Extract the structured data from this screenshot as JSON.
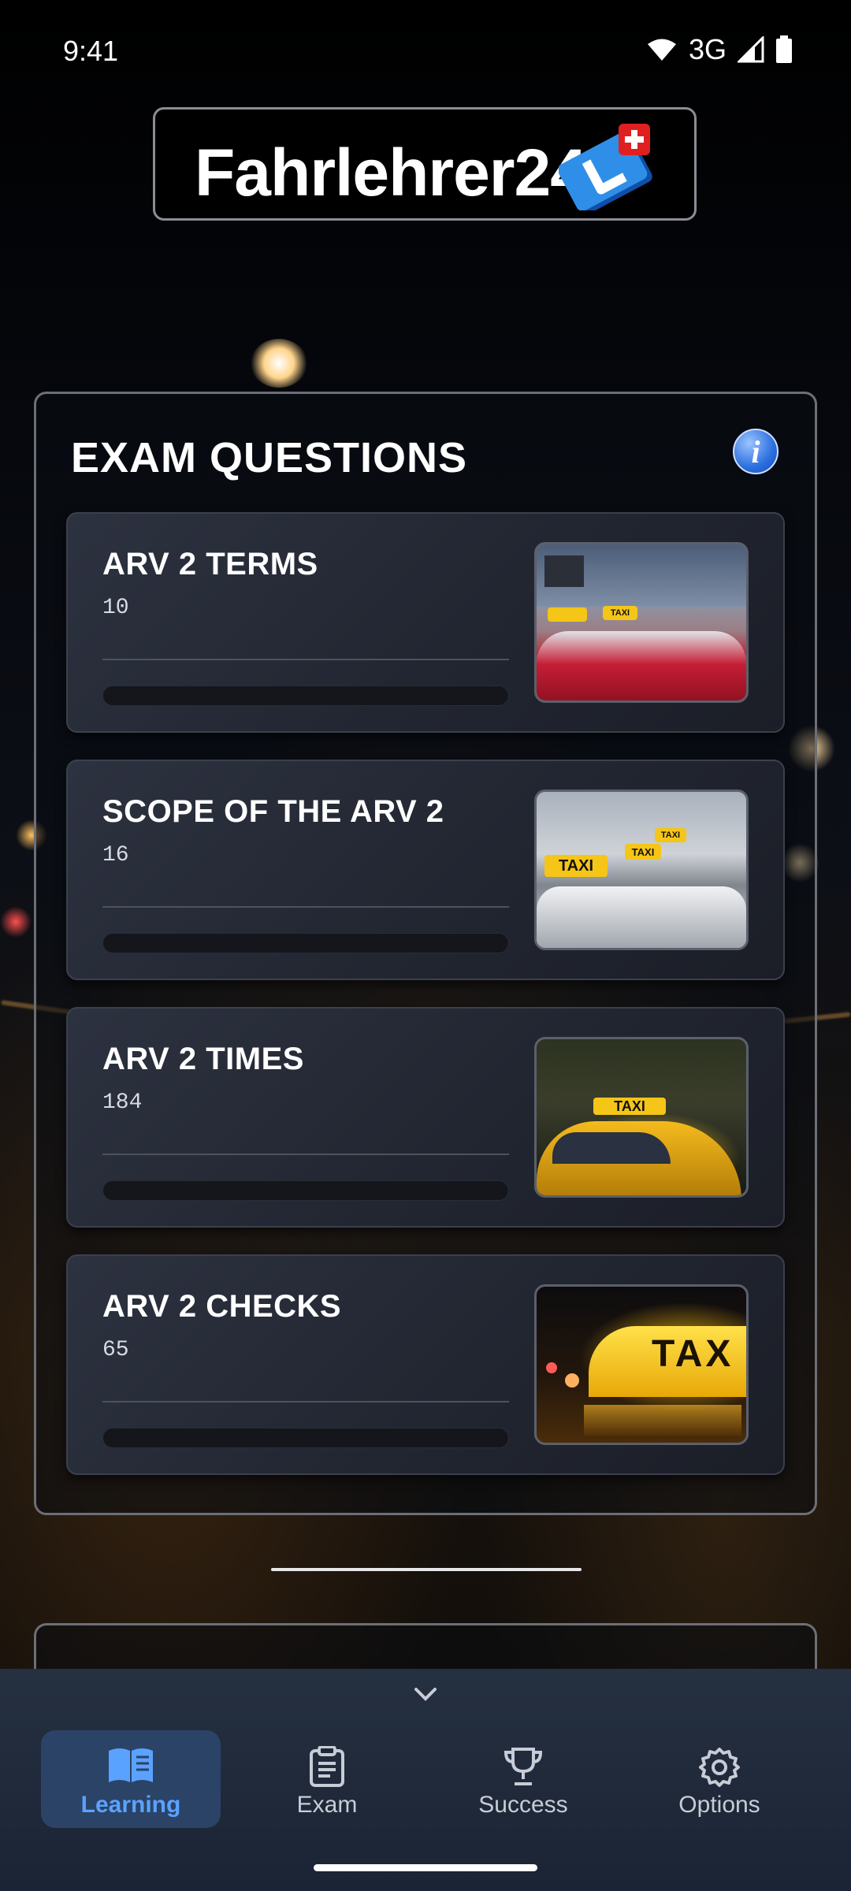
{
  "status_bar": {
    "time": "9:41",
    "network": "3G"
  },
  "logo": {
    "text": "Fahrlehrer24"
  },
  "exam_panel": {
    "title": "EXAM QUESTIONS",
    "cards": [
      {
        "title": "ARV 2 TERMS",
        "count": "10",
        "progress": 0
      },
      {
        "title": "SCOPE OF THE ARV 2",
        "count": "16",
        "progress": 0
      },
      {
        "title": "ARV 2 TIMES",
        "count": "184",
        "progress": 0
      },
      {
        "title": "ARV 2 CHECKS",
        "count": "65",
        "progress": 0
      }
    ]
  },
  "thumb_signs": {
    "taxi": "TAXI",
    "taxi_partial": "TAX"
  },
  "bottom_nav": {
    "items": [
      {
        "label": "Learning",
        "icon": "book-icon",
        "active": true
      },
      {
        "label": "Exam",
        "icon": "clipboard-icon",
        "active": false
      },
      {
        "label": "Success",
        "icon": "trophy-icon",
        "active": false
      },
      {
        "label": "Options",
        "icon": "gear-icon",
        "active": false
      }
    ]
  },
  "colors": {
    "accent": "#5aa2ff",
    "nav_bg": "#1b2434",
    "card_bg": "#252a36"
  }
}
